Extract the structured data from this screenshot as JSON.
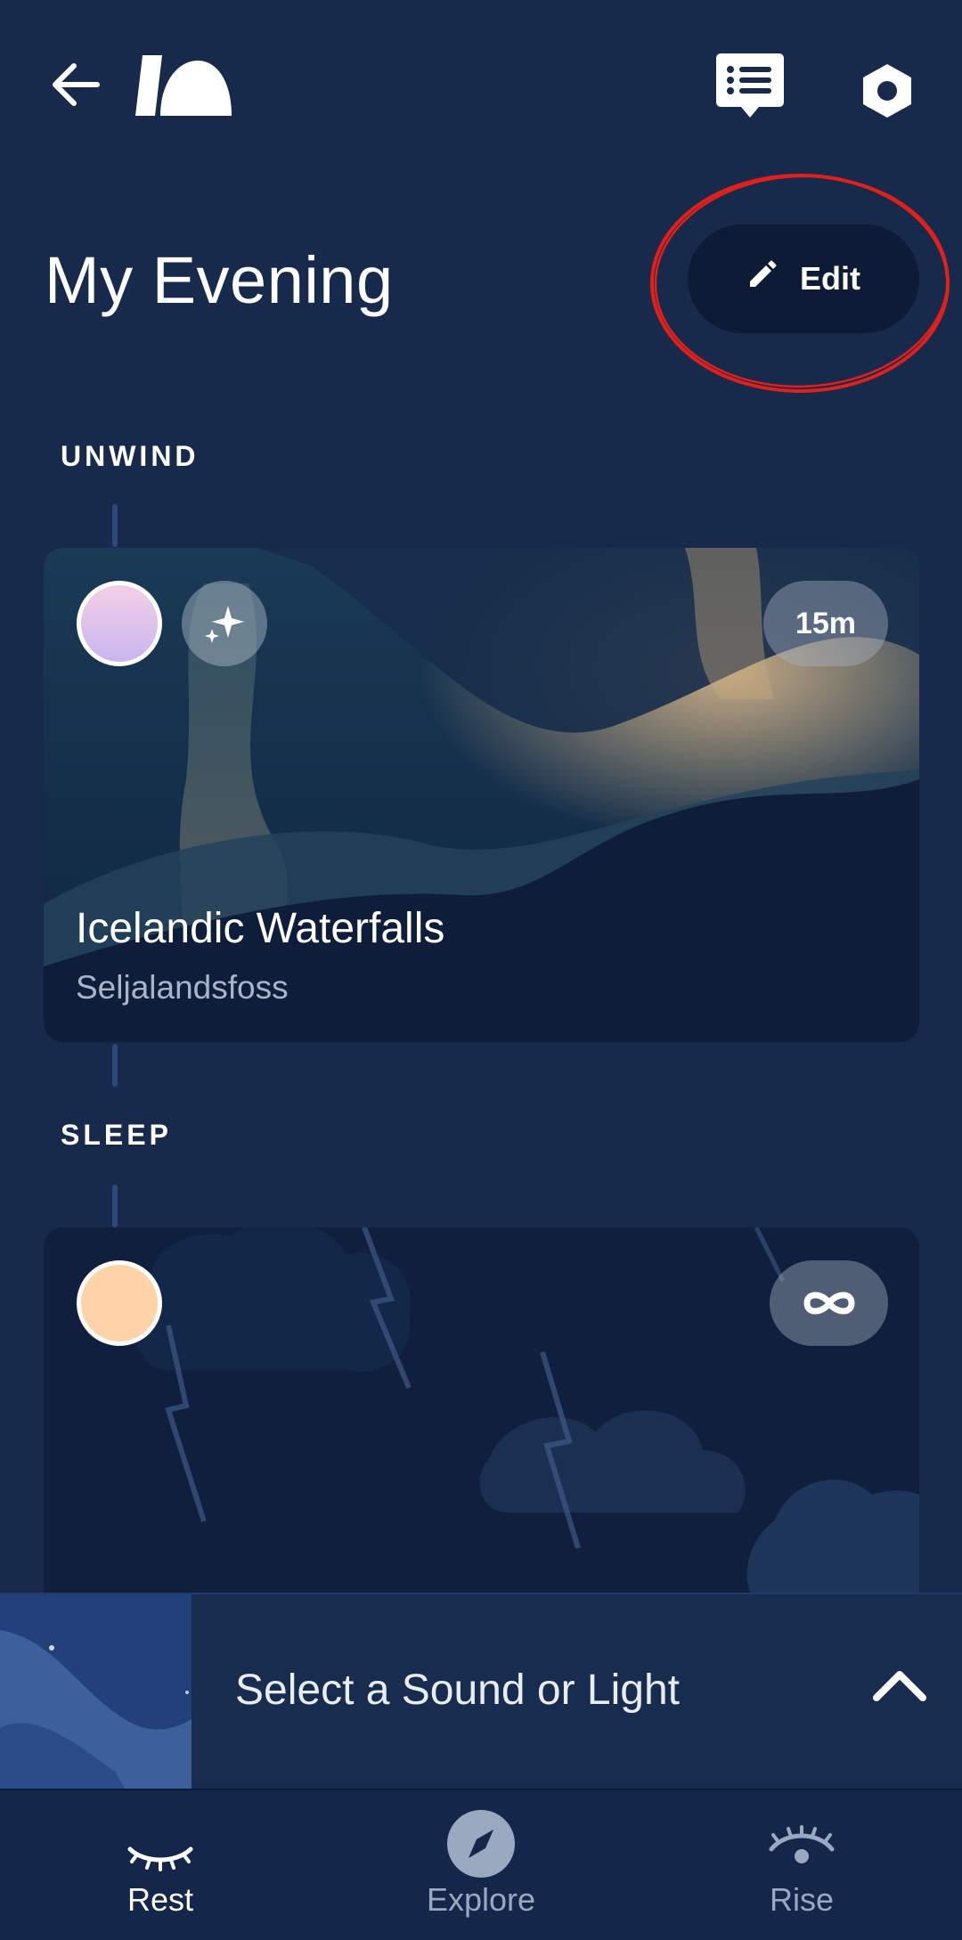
{
  "header": {
    "back_icon": "back-arrow-icon",
    "logo_icon": "hatch-logo-icon",
    "chat_icon": "chat-list-icon",
    "settings_icon": "settings-hexagon-icon"
  },
  "page": {
    "title": "My Evening",
    "edit_label": "Edit",
    "edit_icon": "pencil-icon"
  },
  "sections": [
    {
      "label": "UNWIND",
      "card": {
        "title": "Icelandic Waterfalls",
        "subtitle": "Seljalandsfoss",
        "duration": "15m",
        "color_chip": "#e9c3e8",
        "sparkle_icon": "sparkles-icon"
      }
    },
    {
      "label": "SLEEP",
      "card": {
        "duration_icon": "infinity-icon",
        "color_chip": "#ffd3a8"
      }
    }
  ],
  "player": {
    "prompt": "Select a Sound or Light",
    "chevron_icon": "chevron-up-icon"
  },
  "nav": {
    "items": [
      {
        "label": "Rest",
        "icon": "closed-eye-icon",
        "active": true
      },
      {
        "label": "Explore",
        "icon": "compass-icon",
        "active": false
      },
      {
        "label": "Rise",
        "icon": "open-eye-icon",
        "active": false
      }
    ]
  },
  "colors": {
    "background": "#172a4c",
    "edit_button": "#0d1b36",
    "annotation": "#e0201b",
    "nav_active": "#ffffff",
    "nav_inactive": "#9aa8c0"
  }
}
